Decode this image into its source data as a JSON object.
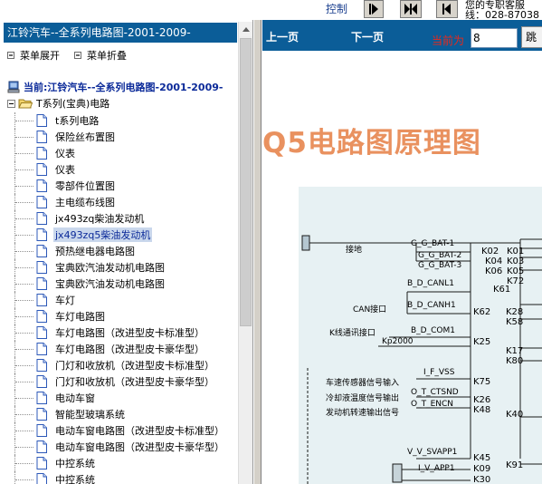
{
  "topbar": {
    "control_label": "控制",
    "info_line1": "您的专职客服",
    "info_line2": "线：028-87038"
  },
  "left_panel": {
    "title": "江铃汽车--全系列电路图-2001-2009-",
    "expand_all": "菜单展开",
    "collapse_all": "菜单折叠",
    "current_path": "当前:江铃汽车--全系列电路图-2001-2009-",
    "folder": "T系列(宝典)电路",
    "items": [
      {
        "label": "t系列电路"
      },
      {
        "label": "保险丝布置图"
      },
      {
        "label": "仪表"
      },
      {
        "label": "仪表"
      },
      {
        "label": "零部件位置图"
      },
      {
        "label": "主电缆布线图"
      },
      {
        "label": "jx493zq柴油发动机"
      },
      {
        "label": "jx493zq5柴油发动机"
      },
      {
        "label": "预热继电器电路图"
      },
      {
        "label": "宝典欧汽油发动机电路图"
      },
      {
        "label": "宝典欧汽油发动机电路图"
      },
      {
        "label": "车灯"
      },
      {
        "label": "车灯电路图"
      },
      {
        "label": "车灯电路图（改进型皮卡标准型）"
      },
      {
        "label": "车灯电路图（改进型皮卡豪华型）"
      },
      {
        "label": "门灯和收放机（改进型皮卡标准型）"
      },
      {
        "label": "门灯和收放机（改进型皮卡豪华型）"
      },
      {
        "label": "电动车窗"
      },
      {
        "label": "智能型玻璃系统"
      },
      {
        "label": "电动车窗电路图（改进型皮卡标准型）"
      },
      {
        "label": "电动车窗电路图（改进型皮卡豪华型）"
      },
      {
        "label": "中控系统"
      },
      {
        "label": "中控系统"
      }
    ],
    "selected_index": 7
  },
  "navbar": {
    "prev": "上一页",
    "next": "下一页",
    "current_label": "当前为",
    "page_value": "8",
    "jump": "跳"
  },
  "document": {
    "title": "Q5电路图原理图",
    "left_labels": {
      "ground": "接地",
      "can": "CAN接口",
      "k_line": "K线通讯接口",
      "speed_in": "车速传感器信号输入",
      "coolant_out": "冷却液温度信号输出",
      "rpm_out": "发动机转速输出信号"
    },
    "signals": {
      "bat1": "G_G_BAT-1",
      "bat2": "G_G_BAT-2",
      "bat3": "G_G_BAT-3",
      "canl": "B_D_CANL1",
      "canh": "B_D_CANH1",
      "com1": "B_D_COM1",
      "kp": "Kp2000",
      "vss": "I_F_VSS",
      "ctsnd": "O_T_CTSND",
      "encn": "O_T_ENCN",
      "svapp": "V_V_SVAPP1",
      "app": "I_V_APP1"
    },
    "pins_left": {
      "k02": "K02",
      "k04": "K04",
      "k06": "K06",
      "k61": "K61",
      "k62": "K62",
      "k25": "K25",
      "k75": "K75",
      "k26": "K26",
      "k48": "K48",
      "k45": "K45",
      "k09": "K09",
      "k30": "K30"
    },
    "pins_right": {
      "k01": "K01",
      "k03": "K03",
      "k05": "K05",
      "k72": "K72",
      "k28": "K28",
      "k58": "K58",
      "k17": "K17",
      "k80": "K80",
      "k40": "K40",
      "k91": "K91"
    }
  },
  "icons": {
    "expand_icon": "square-bullet-icon",
    "collapse_icon": "square-bullet-icon",
    "root_icon": "computer-icon",
    "folder_icon": "open-folder-icon",
    "doc_icon": "document-icon"
  },
  "colors": {
    "header_blue": "#0b5d98",
    "title_orange": "#e9915f",
    "current_red": "#e8291c",
    "selected_bg": "#c9d7ec",
    "diagram_bg": "#e7f1f3"
  }
}
